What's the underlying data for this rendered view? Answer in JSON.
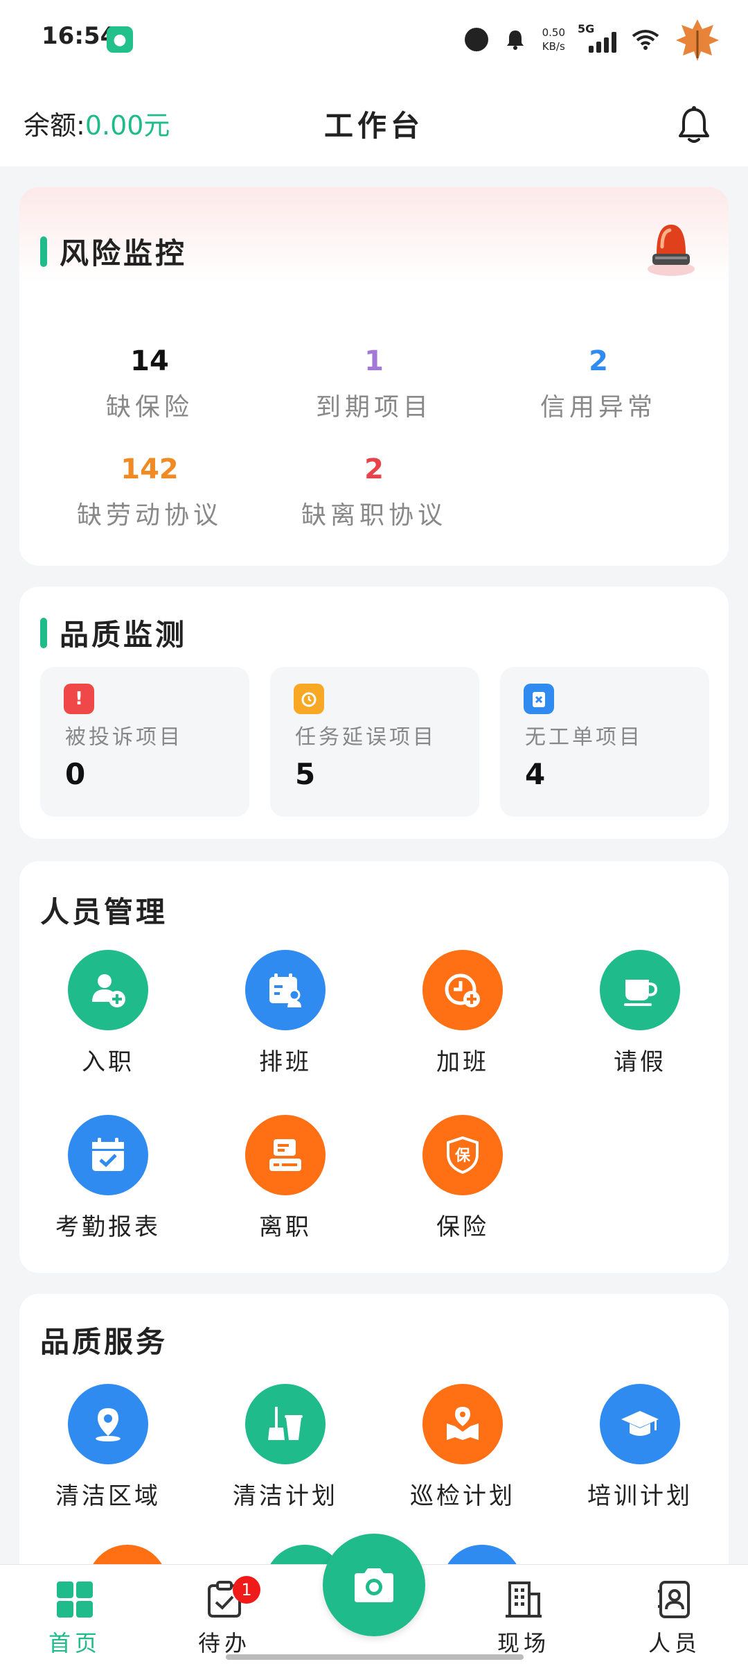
{
  "status_bar": {
    "time": "16:54",
    "net_speed_value": "0.50",
    "net_speed_unit": "KB/s",
    "network": "5G"
  },
  "header": {
    "balance_label": "余额:",
    "balance_value": "0.00元",
    "title": "工作台"
  },
  "risk_monitor": {
    "title": "风险监控",
    "metrics": [
      {
        "value": "14",
        "label": "缺保险",
        "color": "#111111"
      },
      {
        "value": "1",
        "label": "到期项目",
        "color": "#a478d6"
      },
      {
        "value": "2",
        "label": "信用异常",
        "color": "#2f8bf0"
      },
      {
        "value": "142",
        "label": "缺劳动协议",
        "color": "#f08a24"
      },
      {
        "value": "2",
        "label": "缺离职协议",
        "color": "#e8424a"
      }
    ]
  },
  "quality_monitor": {
    "title": "品质监测",
    "tiles": [
      {
        "label": "被投诉项目",
        "value": "0",
        "icon": "alert-icon",
        "color": "#f04848"
      },
      {
        "label": "任务延误项目",
        "value": "5",
        "icon": "alarm-clock-icon",
        "color": "#f9a825"
      },
      {
        "label": "无工单项目",
        "value": "4",
        "icon": "clipboard-x-icon",
        "color": "#2f8bf0"
      }
    ]
  },
  "personnel": {
    "title": "人员管理",
    "items": [
      {
        "label": "入职",
        "icon": "add-user-icon"
      },
      {
        "label": "排班",
        "icon": "schedule-icon"
      },
      {
        "label": "加班",
        "icon": "overtime-icon"
      },
      {
        "label": "请假",
        "icon": "coffee-cup-icon"
      },
      {
        "label": "考勤报表",
        "icon": "calendar-check-icon"
      },
      {
        "label": "离职",
        "icon": "resign-icon"
      },
      {
        "label": "保险",
        "icon": "insurance-shield-icon",
        "glyph": "保"
      }
    ]
  },
  "quality_service": {
    "title": "品质服务",
    "items": [
      {
        "label": "清洁区域",
        "icon": "location-pin-icon"
      },
      {
        "label": "清洁计划",
        "icon": "broom-bucket-icon"
      },
      {
        "label": "巡检计划",
        "icon": "patrol-map-icon"
      },
      {
        "label": "培训计划",
        "icon": "graduation-cap-icon"
      }
    ]
  },
  "bottom_nav": {
    "items": [
      {
        "label": "首页",
        "icon": "home-grid-icon",
        "active": true
      },
      {
        "label": "待办",
        "icon": "todo-clipboard-icon",
        "badge": "1"
      },
      {
        "label": "现场",
        "icon": "building-icon"
      },
      {
        "label": "人员",
        "icon": "contact-book-icon"
      }
    ],
    "center_icon": "camera-icon"
  },
  "colors": {
    "accent_green": "#1fbb8a",
    "accent_blue": "#2f8bf0",
    "accent_orange": "#ff6f14"
  }
}
